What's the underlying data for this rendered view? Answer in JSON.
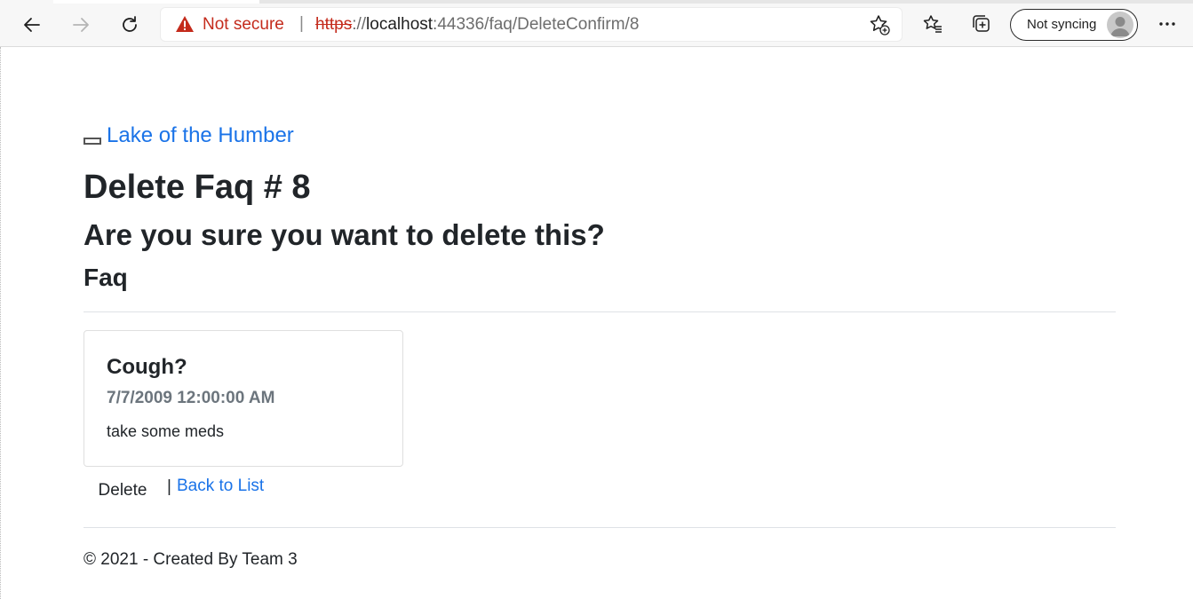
{
  "browser": {
    "not_secure_label": "Not secure",
    "url_scheme": "https",
    "url_sep": "://",
    "url_host": "localhost",
    "url_rest": ":44336/faq/DeleteConfirm/8",
    "profile_label": "Not syncing",
    "icons": [
      "back-arrow-icon",
      "forward-arrow-icon",
      "refresh-icon",
      "warning-icon",
      "add-favorite-icon",
      "favorites-icon",
      "collections-icon",
      "avatar-icon",
      "more-icon"
    ],
    "colors": {
      "warning": "#c42b1c",
      "link": "#1a73e8"
    }
  },
  "page": {
    "brand_label": "Lake of the Humber",
    "title": "Delete Faq # 8",
    "confirm_question": "Are you sure you want to delete this?",
    "entity_heading": "Faq",
    "faq": {
      "question": "Cough?",
      "date": "7/7/2009 12:00:00 AM",
      "answer": "take some meds"
    },
    "delete_label": "Delete",
    "separator": "|",
    "back_label": "Back to List",
    "footer": "© 2021 - Created By Team 3"
  }
}
